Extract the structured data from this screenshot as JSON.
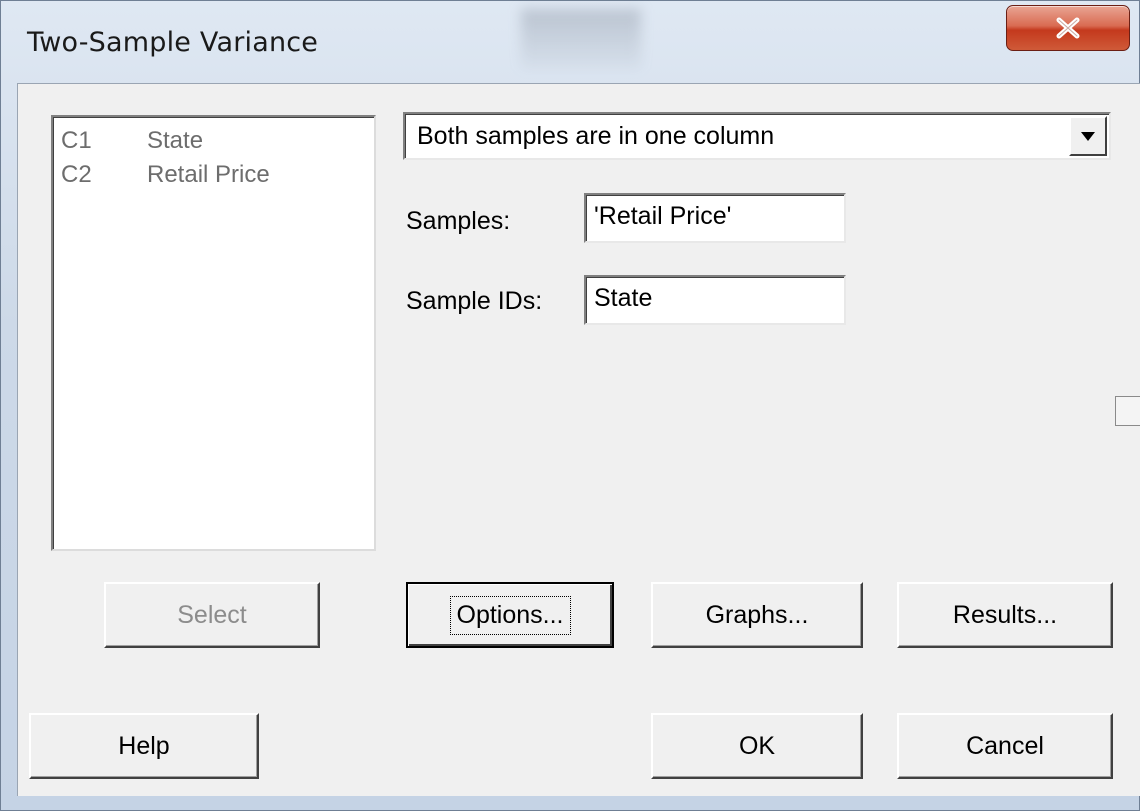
{
  "window": {
    "title": "Two-Sample Variance",
    "close_icon": "close-icon"
  },
  "variables": [
    {
      "column": "C1",
      "name": "State"
    },
    {
      "column": "C2",
      "name": "Retail Price"
    }
  ],
  "sample_mode": {
    "selected": "Both samples are in one column"
  },
  "fields": {
    "samples_label": "Samples:",
    "samples_value": "'Retail Price'",
    "sample_ids_label": "Sample IDs:",
    "sample_ids_value": "State"
  },
  "buttons": {
    "select": "Select",
    "options": "Options...",
    "graphs": "Graphs...",
    "results": "Results...",
    "help": "Help",
    "ok": "OK",
    "cancel": "Cancel"
  },
  "colors": {
    "close_button": "#c4391d",
    "dialog_background": "#f0f0f0",
    "disabled_text": "#8c8c8c"
  }
}
